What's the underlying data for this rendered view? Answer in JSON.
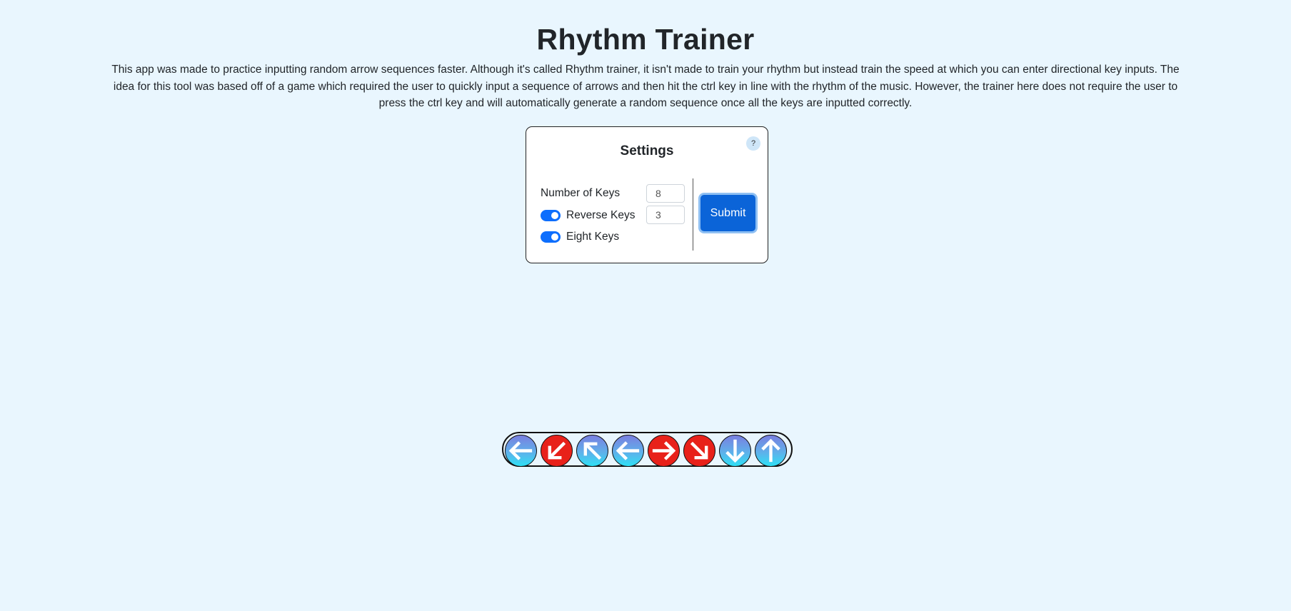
{
  "header": {
    "title": "Rhythm Trainer",
    "description": "This app was made to practice inputting random arrow sequences faster. Although it's called Rhythm trainer, it isn't made to train your rhythm but instead train the speed at which you can enter directional key inputs. The idea for this tool was based off of a game which required the user to quickly input a sequence of arrows and then hit the ctrl key in line with the rhythm of the music. However, the trainer here does not require the user to press the ctrl key and will automatically generate a random sequence once all the keys are inputted correctly."
  },
  "settings": {
    "title": "Settings",
    "help_label": "?",
    "number_of_keys_label": "Number of Keys",
    "number_of_keys_value": "8",
    "reverse_keys_label": "Reverse Keys",
    "reverse_keys_enabled": true,
    "reverse_keys_value": "3",
    "eight_keys_label": "Eight Keys",
    "eight_keys_enabled": true,
    "submit_label": "Submit"
  },
  "colors": {
    "background": "#e9f6fe",
    "accent": "#0b64d8",
    "reverse_arrow": "#e8211a"
  },
  "sequence": [
    {
      "direction": "left",
      "reversed": false,
      "icon": "arrow-left-icon"
    },
    {
      "direction": "down-left",
      "reversed": true,
      "icon": "arrow-down-left-icon"
    },
    {
      "direction": "up-left",
      "reversed": false,
      "icon": "arrow-up-left-icon"
    },
    {
      "direction": "left",
      "reversed": false,
      "icon": "arrow-left-icon"
    },
    {
      "direction": "right",
      "reversed": true,
      "icon": "arrow-right-icon"
    },
    {
      "direction": "down-right",
      "reversed": true,
      "icon": "arrow-down-right-icon"
    },
    {
      "direction": "down",
      "reversed": false,
      "icon": "arrow-down-icon"
    },
    {
      "direction": "up",
      "reversed": false,
      "icon": "arrow-up-icon"
    }
  ]
}
